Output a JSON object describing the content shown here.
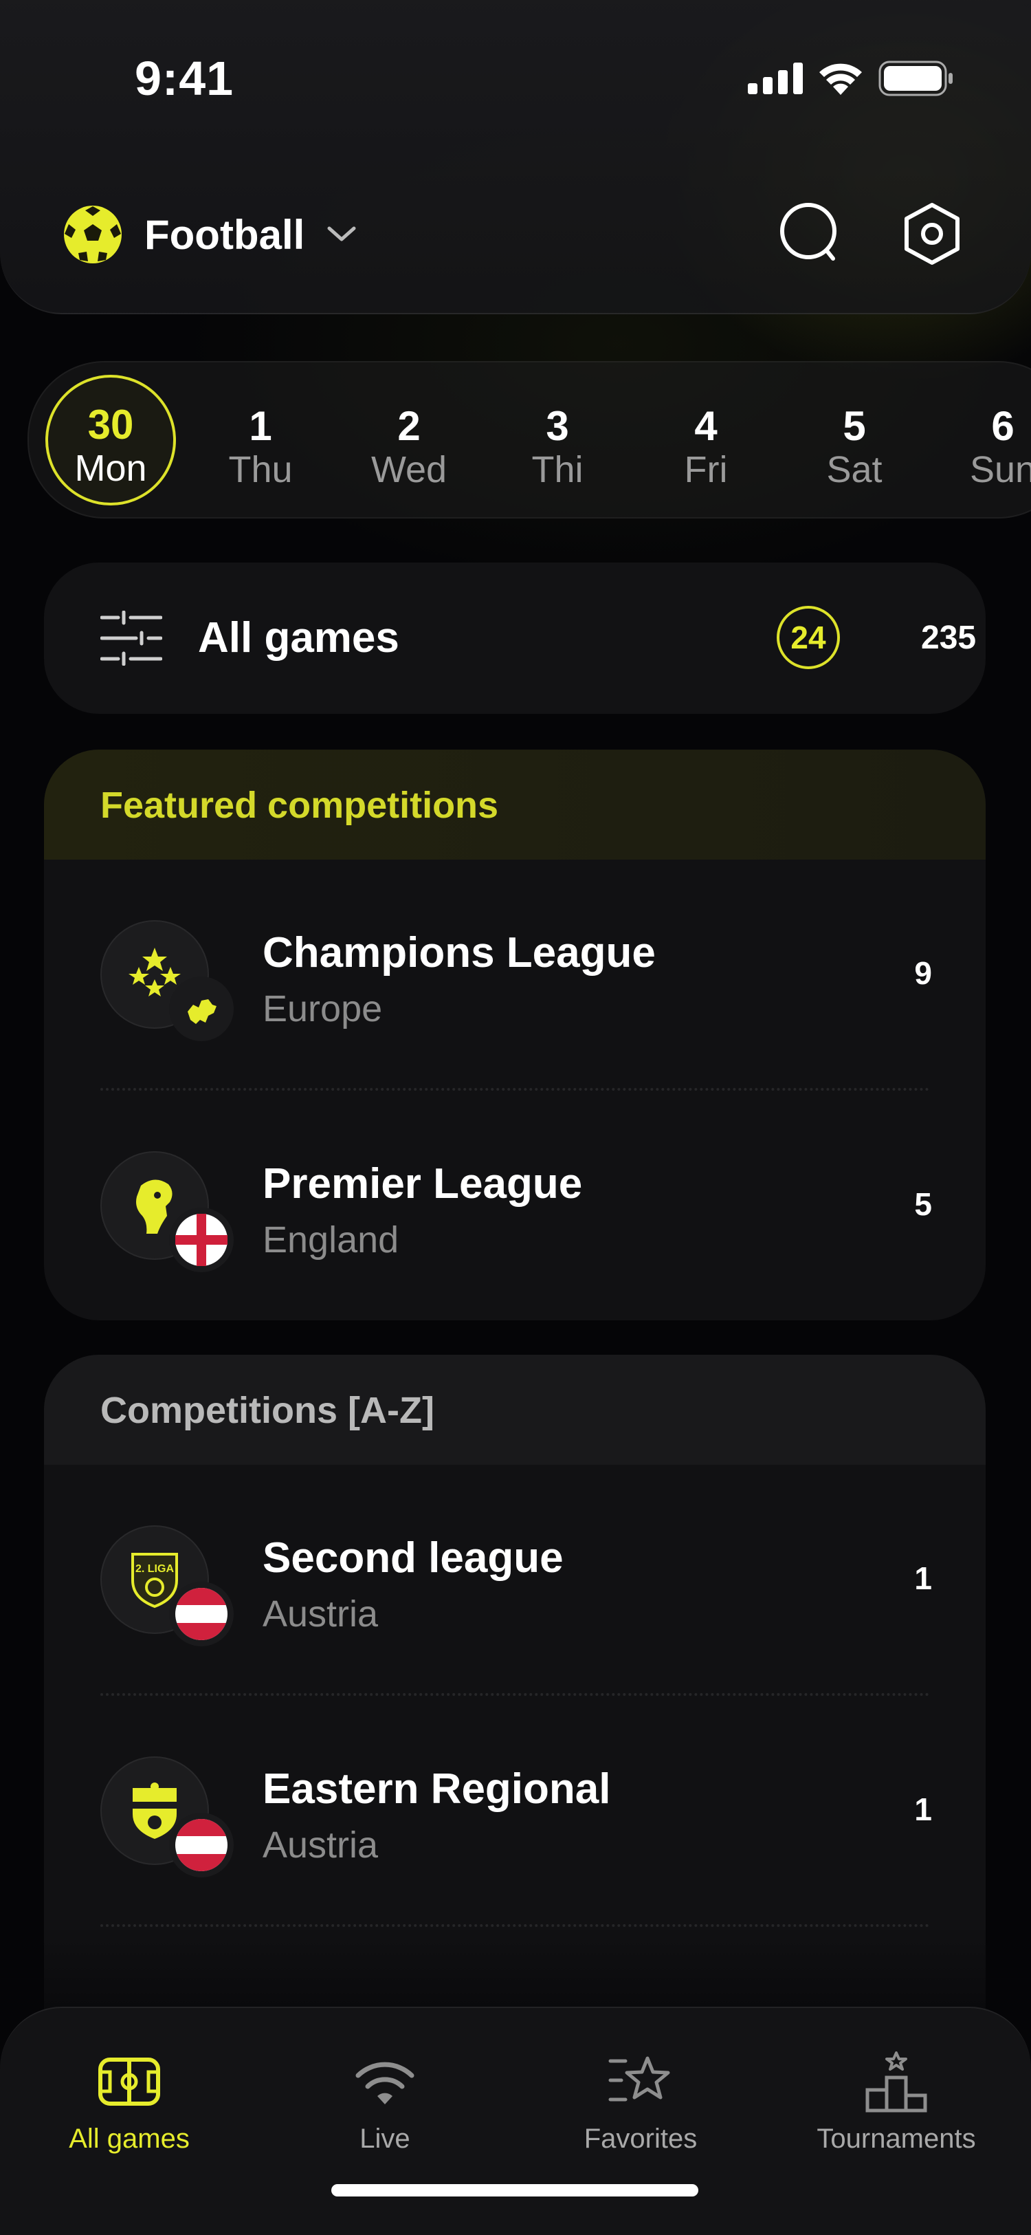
{
  "status_bar": {
    "time": "9:41"
  },
  "header": {
    "sport": "Football"
  },
  "dates": [
    {
      "num": "30",
      "day": "Mon",
      "active": true
    },
    {
      "num": "1",
      "day": "Thu"
    },
    {
      "num": "2",
      "day": "Wed"
    },
    {
      "num": "3",
      "day": "Thi"
    },
    {
      "num": "4",
      "day": "Fri"
    },
    {
      "num": "5",
      "day": "Sat"
    },
    {
      "num": "6",
      "day": "Sun"
    }
  ],
  "all_games": {
    "label": "All games",
    "live_count": "24",
    "total_count": "235"
  },
  "featured": {
    "title": "Featured competitions",
    "items": [
      {
        "name": "Champions League",
        "country": "Europe",
        "count": "9"
      },
      {
        "name": "Premier League",
        "country": "England",
        "count": "5"
      }
    ]
  },
  "az": {
    "title": "Competitions [A-Z]",
    "items": [
      {
        "name": "Second league",
        "country": "Austria",
        "count": "1",
        "logo_text": "2. LIGA"
      },
      {
        "name": "Eastern Regional",
        "country": "Austria",
        "count": "1"
      }
    ]
  },
  "nav": {
    "items": [
      {
        "label": "All games",
        "icon": "field-icon",
        "active": true
      },
      {
        "label": "Live",
        "icon": "live-icon"
      },
      {
        "label": "Favorites",
        "icon": "star-icon"
      },
      {
        "label": "Tournaments",
        "icon": "podium-icon"
      }
    ]
  },
  "colors": {
    "accent": "#E6EC2C",
    "background": "#050507",
    "card": "#111113"
  }
}
